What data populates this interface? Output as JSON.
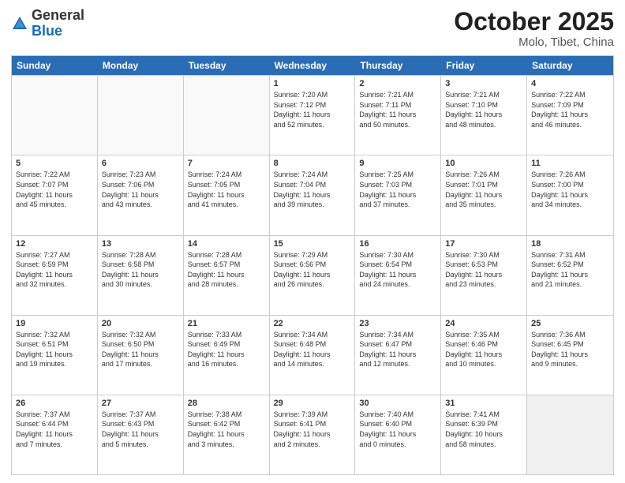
{
  "header": {
    "logo_general": "General",
    "logo_blue": "Blue",
    "month_title": "October 2025",
    "subtitle": "Molo, Tibet, China"
  },
  "day_headers": [
    "Sunday",
    "Monday",
    "Tuesday",
    "Wednesday",
    "Thursday",
    "Friday",
    "Saturday"
  ],
  "weeks": [
    [
      {
        "day": "",
        "info": ""
      },
      {
        "day": "",
        "info": ""
      },
      {
        "day": "",
        "info": ""
      },
      {
        "day": "1",
        "info": "Sunrise: 7:20 AM\nSunset: 7:12 PM\nDaylight: 11 hours\nand 52 minutes."
      },
      {
        "day": "2",
        "info": "Sunrise: 7:21 AM\nSunset: 7:11 PM\nDaylight: 11 hours\nand 50 minutes."
      },
      {
        "day": "3",
        "info": "Sunrise: 7:21 AM\nSunset: 7:10 PM\nDaylight: 11 hours\nand 48 minutes."
      },
      {
        "day": "4",
        "info": "Sunrise: 7:22 AM\nSunset: 7:09 PM\nDaylight: 11 hours\nand 46 minutes."
      }
    ],
    [
      {
        "day": "5",
        "info": "Sunrise: 7:22 AM\nSunset: 7:07 PM\nDaylight: 11 hours\nand 45 minutes."
      },
      {
        "day": "6",
        "info": "Sunrise: 7:23 AM\nSunset: 7:06 PM\nDaylight: 11 hours\nand 43 minutes."
      },
      {
        "day": "7",
        "info": "Sunrise: 7:24 AM\nSunset: 7:05 PM\nDaylight: 11 hours\nand 41 minutes."
      },
      {
        "day": "8",
        "info": "Sunrise: 7:24 AM\nSunset: 7:04 PM\nDaylight: 11 hours\nand 39 minutes."
      },
      {
        "day": "9",
        "info": "Sunrise: 7:25 AM\nSunset: 7:03 PM\nDaylight: 11 hours\nand 37 minutes."
      },
      {
        "day": "10",
        "info": "Sunrise: 7:26 AM\nSunset: 7:01 PM\nDaylight: 11 hours\nand 35 minutes."
      },
      {
        "day": "11",
        "info": "Sunrise: 7:26 AM\nSunset: 7:00 PM\nDaylight: 11 hours\nand 34 minutes."
      }
    ],
    [
      {
        "day": "12",
        "info": "Sunrise: 7:27 AM\nSunset: 6:59 PM\nDaylight: 11 hours\nand 32 minutes."
      },
      {
        "day": "13",
        "info": "Sunrise: 7:28 AM\nSunset: 6:58 PM\nDaylight: 11 hours\nand 30 minutes."
      },
      {
        "day": "14",
        "info": "Sunrise: 7:28 AM\nSunset: 6:57 PM\nDaylight: 11 hours\nand 28 minutes."
      },
      {
        "day": "15",
        "info": "Sunrise: 7:29 AM\nSunset: 6:56 PM\nDaylight: 11 hours\nand 26 minutes."
      },
      {
        "day": "16",
        "info": "Sunrise: 7:30 AM\nSunset: 6:54 PM\nDaylight: 11 hours\nand 24 minutes."
      },
      {
        "day": "17",
        "info": "Sunrise: 7:30 AM\nSunset: 6:53 PM\nDaylight: 11 hours\nand 23 minutes."
      },
      {
        "day": "18",
        "info": "Sunrise: 7:31 AM\nSunset: 6:52 PM\nDaylight: 11 hours\nand 21 minutes."
      }
    ],
    [
      {
        "day": "19",
        "info": "Sunrise: 7:32 AM\nSunset: 6:51 PM\nDaylight: 11 hours\nand 19 minutes."
      },
      {
        "day": "20",
        "info": "Sunrise: 7:32 AM\nSunset: 6:50 PM\nDaylight: 11 hours\nand 17 minutes."
      },
      {
        "day": "21",
        "info": "Sunrise: 7:33 AM\nSunset: 6:49 PM\nDaylight: 11 hours\nand 16 minutes."
      },
      {
        "day": "22",
        "info": "Sunrise: 7:34 AM\nSunset: 6:48 PM\nDaylight: 11 hours\nand 14 minutes."
      },
      {
        "day": "23",
        "info": "Sunrise: 7:34 AM\nSunset: 6:47 PM\nDaylight: 11 hours\nand 12 minutes."
      },
      {
        "day": "24",
        "info": "Sunrise: 7:35 AM\nSunset: 6:46 PM\nDaylight: 11 hours\nand 10 minutes."
      },
      {
        "day": "25",
        "info": "Sunrise: 7:36 AM\nSunset: 6:45 PM\nDaylight: 11 hours\nand 9 minutes."
      }
    ],
    [
      {
        "day": "26",
        "info": "Sunrise: 7:37 AM\nSunset: 6:44 PM\nDaylight: 11 hours\nand 7 minutes."
      },
      {
        "day": "27",
        "info": "Sunrise: 7:37 AM\nSunset: 6:43 PM\nDaylight: 11 hours\nand 5 minutes."
      },
      {
        "day": "28",
        "info": "Sunrise: 7:38 AM\nSunset: 6:42 PM\nDaylight: 11 hours\nand 3 minutes."
      },
      {
        "day": "29",
        "info": "Sunrise: 7:39 AM\nSunset: 6:41 PM\nDaylight: 11 hours\nand 2 minutes."
      },
      {
        "day": "30",
        "info": "Sunrise: 7:40 AM\nSunset: 6:40 PM\nDaylight: 11 hours\nand 0 minutes."
      },
      {
        "day": "31",
        "info": "Sunrise: 7:41 AM\nSunset: 6:39 PM\nDaylight: 10 hours\nand 58 minutes."
      },
      {
        "day": "",
        "info": ""
      }
    ]
  ]
}
